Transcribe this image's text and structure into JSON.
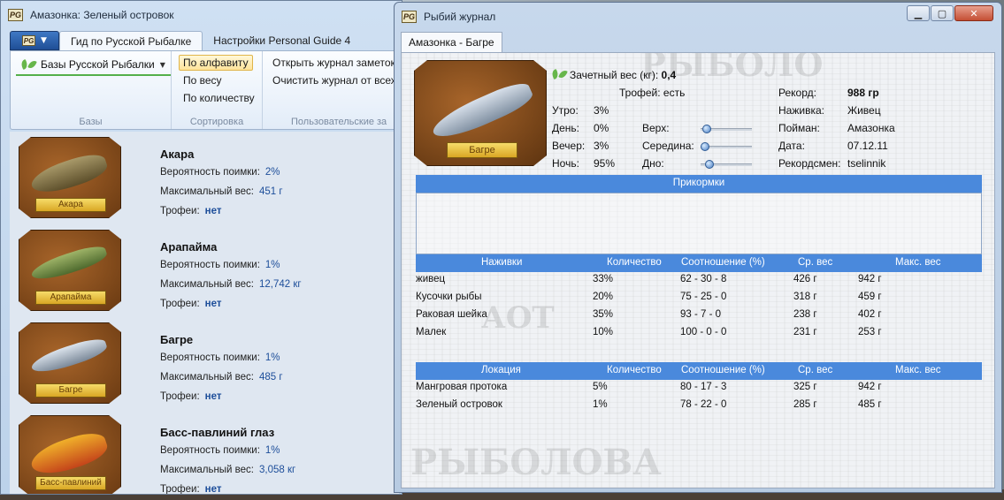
{
  "main_window": {
    "title": "Амазонка: Зеленый островок",
    "tabs": [
      "Гид по Русской Рыбалке",
      "Настройки Personal Guide 4"
    ],
    "ribbon": {
      "bases_button": "Базы Русской Рыбалки",
      "group_bases": "Базы",
      "sort_options": [
        "По алфавиту",
        "По весу",
        "По количеству"
      ],
      "group_sort": "Сортировка",
      "actions": [
        "Открыть журнал заметок",
        "Очистить журнал от всех"
      ],
      "group_user": "Пользовательские за"
    }
  },
  "fish_list": [
    {
      "name": "Акара",
      "prob_label": "Вероятность поимки:",
      "prob": "2%",
      "maxw_label": "Максимальный вес:",
      "maxw": "451 г",
      "trophy_label": "Трофеи:",
      "trophy": "нет",
      "plaque": "Акара",
      "color": "#8f7b48"
    },
    {
      "name": "Арапайма",
      "prob_label": "Вероятность поимки:",
      "prob": "1%",
      "maxw_label": "Максимальный вес:",
      "maxw": "12,742 кг",
      "trophy_label": "Трофеи:",
      "trophy": "нет",
      "plaque": "Арапайма",
      "color": "#7d9a52"
    },
    {
      "name": "Багре",
      "prob_label": "Вероятность поимки:",
      "prob": "1%",
      "maxw_label": "Максимальный вес:",
      "maxw": "485 г",
      "trophy_label": "Трофеи:",
      "trophy": "нет",
      "plaque": "Багре",
      "color": "#9aa8b8"
    },
    {
      "name": "Басс-павлиний глаз",
      "prob_label": "Вероятность поимки:",
      "prob": "1%",
      "maxw_label": "Максимальный вес:",
      "maxw": "3,058 кг",
      "trophy_label": "Трофеи:",
      "trophy": "нет",
      "plaque": "Басс-павлиний глаз",
      "color": "#d96a24"
    }
  ],
  "journal": {
    "title": "Рыбий журнал",
    "tab": "Амазонка - Багре",
    "plaque": "Багре",
    "credit_weight_label": "Зачетный вес (кг):",
    "credit_weight": "0,4",
    "trophies": "Трофей: есть",
    "times": [
      {
        "label": "Утро:",
        "value": "3%"
      },
      {
        "label": "День:",
        "value": "0%"
      },
      {
        "label": "Вечер:",
        "value": "3%"
      },
      {
        "label": "Ночь:",
        "value": "95%"
      }
    ],
    "depths": [
      {
        "label": "Верх:",
        "level": 0.05
      },
      {
        "label": "Середина:",
        "level": 0.0
      },
      {
        "label": "Дно:",
        "level": 0.1
      }
    ],
    "record": [
      {
        "label": "Рекорд:",
        "value": "988 гр"
      },
      {
        "label": "Наживка:",
        "value": "Живец"
      },
      {
        "label": "Пойман:",
        "value": "Амазонка"
      },
      {
        "label": "Дата:",
        "value": "07.12.11"
      },
      {
        "label": "Рекордсмен:",
        "value": "tselinnik"
      }
    ],
    "groundbait_header": "Прикормки",
    "bait_headers": [
      "Наживки",
      "Количество",
      "Соотношение (%)",
      "Ср. вес",
      "Макс. вес"
    ],
    "baits": [
      [
        "живец",
        "33%",
        "62 - 30 - 8",
        "426 г",
        "942 г"
      ],
      [
        "Кусочки рыбы",
        "20%",
        "75 - 25 - 0",
        "318 г",
        "459 г"
      ],
      [
        "Раковая шейка",
        "35%",
        "93 - 7 - 0",
        "238 г",
        "402 г"
      ],
      [
        "Малек",
        "10%",
        "100 - 0 - 0",
        "231 г",
        "253 г"
      ]
    ],
    "loc_headers": [
      "Локация",
      "Количество",
      "Соотношение (%)",
      "Ср. вес",
      "Макс. вес"
    ],
    "locations": [
      [
        "Мангровая протока",
        "5%",
        "80 - 17 - 3",
        "325 г",
        "942 г"
      ],
      [
        "Зеленый островок",
        "1%",
        "78 - 22 - 0",
        "285 г",
        "485 г"
      ]
    ]
  },
  "colors": {
    "accent": "#4a89dc",
    "value_blue": "#1d4e9a",
    "leaf": "#67b64b",
    "plaque_gold": "#e7c24a"
  }
}
